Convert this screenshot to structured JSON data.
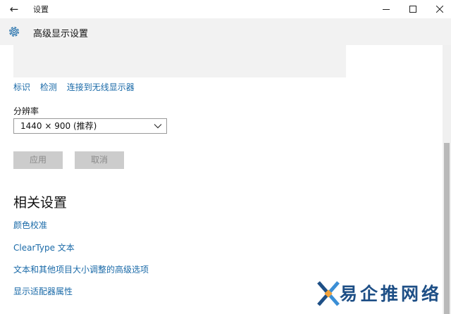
{
  "window": {
    "title": "设置"
  },
  "header": {
    "title": "高级显示设置"
  },
  "display_links": [
    "标识",
    "检测",
    "连接到无线显示器"
  ],
  "resolution": {
    "label": "分辨率",
    "value": "1440 × 900 (推荐)"
  },
  "buttons": {
    "apply": "应用",
    "cancel": "取消"
  },
  "related": {
    "title": "相关设置",
    "links": [
      "颜色校准",
      "ClearType 文本",
      "文本和其他项目大小调整的高级选项",
      "显示适配器属性"
    ]
  },
  "watermark": {
    "text": "易企推网络"
  },
  "colors": {
    "accent": "#1a6aa8",
    "header_bg": "#f2f2f2",
    "disabled_button": "#cccccc"
  }
}
